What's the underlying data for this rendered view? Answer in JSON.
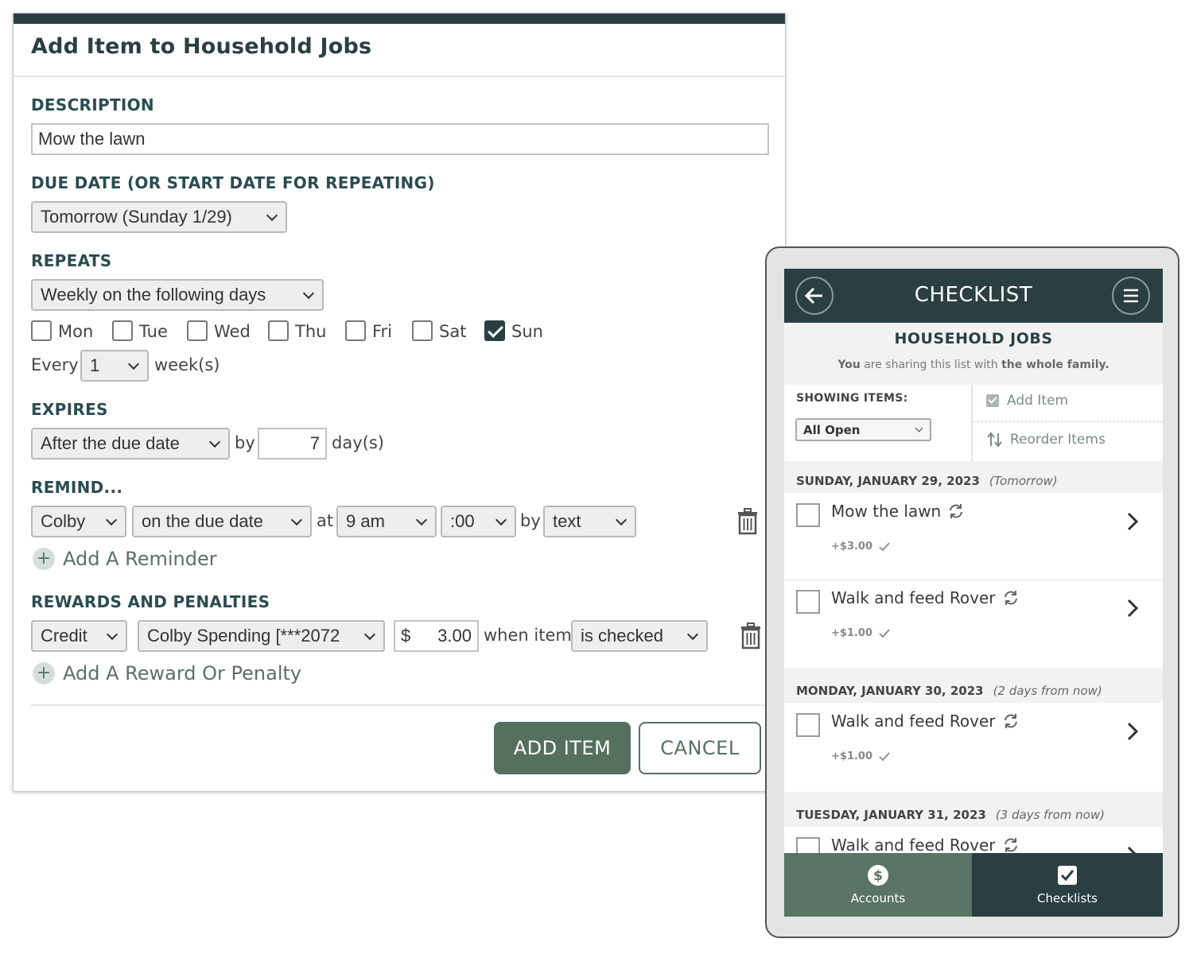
{
  "dialog": {
    "title": "Add Item to Household Jobs",
    "description": {
      "label": "DESCRIPTION",
      "value": "Mow the lawn"
    },
    "due_date": {
      "label": "DUE DATE (OR START DATE FOR REPEATING)",
      "value": "Tomorrow (Sunday 1/29)"
    },
    "repeats": {
      "label": "REPEATS",
      "value": "Weekly on the following days",
      "days": [
        {
          "label": "Mon",
          "checked": false
        },
        {
          "label": "Tue",
          "checked": false
        },
        {
          "label": "Wed",
          "checked": false
        },
        {
          "label": "Thu",
          "checked": false
        },
        {
          "label": "Fri",
          "checked": false
        },
        {
          "label": "Sat",
          "checked": false
        },
        {
          "label": "Sun",
          "checked": true
        }
      ],
      "every_label": "Every",
      "every_value": "1",
      "unit_label": "week(s)"
    },
    "expires": {
      "label": "EXPIRES",
      "value": "After the due date",
      "by_label": "by",
      "days_value": "7",
      "unit_label": "day(s)"
    },
    "remind": {
      "label": "REMIND...",
      "who": "Colby",
      "when": "on the due date",
      "at_label": "at",
      "hour": "9 am",
      "minute": ":00",
      "by_label": "by",
      "method": "text",
      "add_label": "Add A Reminder"
    },
    "rewards": {
      "label": "REWARDS AND PENALTIES",
      "type": "Credit",
      "account": "Colby Spending [***2072",
      "currency": "$",
      "amount": "3.00",
      "when_label": "when item",
      "condition": "is checked",
      "add_label": "Add A Reward Or Penalty"
    },
    "add_button": "ADD ITEM",
    "cancel_button": "CANCEL"
  },
  "phone": {
    "header_title": "CHECKLIST",
    "list_title": "HOUSEHOLD JOBS",
    "share_note": {
      "you": "You",
      "middle": "are sharing this list with",
      "who": "the whole family."
    },
    "showing_label": "SHOWING ITEMS:",
    "filter": "All Open",
    "add_item": "Add Item",
    "reorder_items": "Reorder Items",
    "groups": [
      {
        "date": "SUNDAY, JANUARY 29, 2023",
        "relative": "(Tomorrow)",
        "items": [
          {
            "name": "Mow the lawn",
            "reward": "+$3.00"
          },
          {
            "name": "Walk and feed Rover",
            "reward": "+$1.00"
          }
        ]
      },
      {
        "date": "MONDAY, JANUARY 30, 2023",
        "relative": "(2 days from now)",
        "items": [
          {
            "name": "Walk and feed Rover",
            "reward": "+$1.00"
          }
        ]
      },
      {
        "date": "TUESDAY, JANUARY 31, 2023",
        "relative": "(3 days from now)",
        "items": [
          {
            "name": "Walk and feed Rover",
            "reward": ""
          }
        ]
      }
    ],
    "nav": [
      {
        "label": "Accounts"
      },
      {
        "label": "Checklists"
      }
    ],
    "colors": {
      "header": "#2b3f42",
      "accent": "#56705f",
      "nav_inactive": "#5a7466",
      "nav_active": "#2b3f42"
    }
  }
}
